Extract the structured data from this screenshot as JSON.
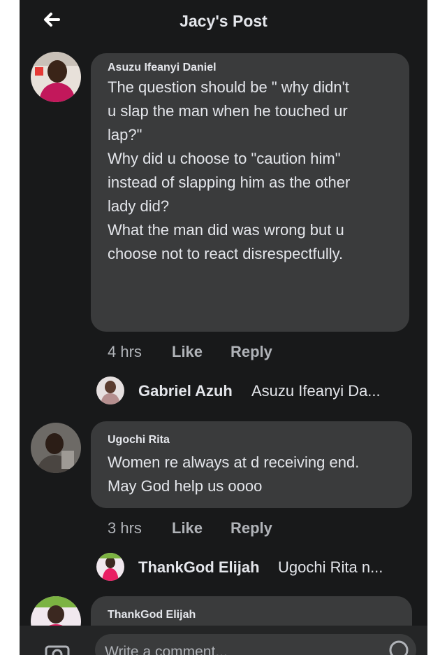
{
  "header": {
    "title": "Jacy's Post"
  },
  "comments": [
    {
      "author": "Asuzu Ifeanyi Daniel",
      "text": "The question should be \" why didn't\nu slap the man when he touched ur\nlap?\"\nWhy did u choose to \"caution him\"\ninstead of slapping him as the other\nlady did?\nWhat the man did was wrong but u\nchoose not to react disrespectfully.",
      "time": "4 hrs",
      "like": "Like",
      "reply": "Reply",
      "reply_preview": {
        "author": "Gabriel Azuh",
        "text": "Asuzu Ifeanyi Da..."
      }
    },
    {
      "author": "Ugochi Rita",
      "text": "Women re always at d receiving end.\nMay God help us oooo",
      "time": "3 hrs",
      "like": "Like",
      "reply": "Reply",
      "reply_preview": {
        "author": "ThankGod Elijah",
        "text": "Ugochi Rita n..."
      }
    },
    {
      "author": "ThankGod Elijah"
    }
  ],
  "composer": {
    "placeholder": "Write a comment..."
  },
  "colors": {
    "background": "#18191a",
    "bubble": "#3a3b3c",
    "text": "#e4e6eb",
    "muted": "#b0b3b8"
  }
}
